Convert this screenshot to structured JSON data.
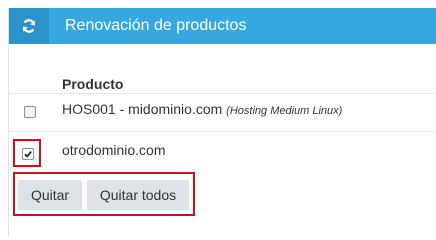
{
  "panel": {
    "title": "Renovación de productos",
    "icon": "refresh-icon",
    "accent_color": "#36a8df"
  },
  "table": {
    "column_header": "Producto",
    "rows": [
      {
        "product": "HOS001 - midominio.com",
        "detail": "(Hosting Medium Linux)",
        "checked": false
      },
      {
        "product": "otrodominio.com",
        "detail": "",
        "checked": true
      }
    ]
  },
  "actions": {
    "remove_label": "Quitar",
    "remove_all_label": "Quitar todos"
  }
}
